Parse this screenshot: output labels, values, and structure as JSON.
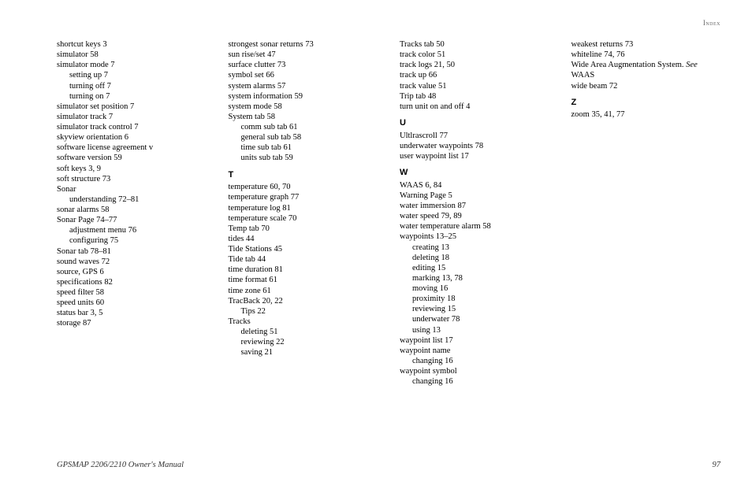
{
  "header": {
    "section": "Index"
  },
  "footer": {
    "title": "GPSMAP 2206/2210 Owner's Manual",
    "page": "97"
  },
  "entries": [
    {
      "t": "shortcut keys  3"
    },
    {
      "t": "simulator  58"
    },
    {
      "t": "simulator mode  7"
    },
    {
      "t": "setting up  7",
      "i": 1
    },
    {
      "t": "turning off  7",
      "i": 1
    },
    {
      "t": "turning on  7",
      "i": 1
    },
    {
      "t": "simulator set position  7"
    },
    {
      "t": "simulator track  7"
    },
    {
      "t": "simulator track control  7"
    },
    {
      "t": "skyview orientation  6"
    },
    {
      "t": "software license agreement  v"
    },
    {
      "t": "software version  59"
    },
    {
      "t": "soft keys  3, 9"
    },
    {
      "t": "soft structure  73"
    },
    {
      "t": "Sonar"
    },
    {
      "t": "understanding  72–81",
      "i": 1
    },
    {
      "t": "sonar alarms  58"
    },
    {
      "t": "Sonar Page  74–77"
    },
    {
      "t": "adjustment menu  76",
      "i": 1
    },
    {
      "t": "configuring  75",
      "i": 1
    },
    {
      "t": "Sonar tab  78–81"
    },
    {
      "t": "sound waves  72"
    },
    {
      "t": "source, GPS  6"
    },
    {
      "t": "specifications  82"
    },
    {
      "t": "speed filter  58"
    },
    {
      "t": "speed units  60"
    },
    {
      "t": "status bar  3, 5"
    },
    {
      "t": "storage  87"
    },
    {
      "t": "strongest sonar returns  73",
      "break": true
    },
    {
      "t": "sun rise/set  47"
    },
    {
      "t": "surface clutter  73"
    },
    {
      "t": "symbol set  66"
    },
    {
      "t": "system alarms  57"
    },
    {
      "t": "system information  59"
    },
    {
      "t": "system mode  58"
    },
    {
      "t": "System tab  58"
    },
    {
      "t": "comm sub tab  61",
      "i": 1
    },
    {
      "t": "general sub tab  58",
      "i": 1
    },
    {
      "t": "time sub tab  61",
      "i": 1
    },
    {
      "t": "units sub tab  59",
      "i": 1
    },
    {
      "letter": "T"
    },
    {
      "t": "temperature  60, 70"
    },
    {
      "t": "temperature graph  77"
    },
    {
      "t": "temperature log  81"
    },
    {
      "t": "temperature scale  70"
    },
    {
      "t": "Temp tab  70"
    },
    {
      "t": "tides  44"
    },
    {
      "t": "Tide Stations  45"
    },
    {
      "t": "Tide tab  44"
    },
    {
      "t": "time duration  81"
    },
    {
      "t": "time format  61"
    },
    {
      "t": "time zone  61"
    },
    {
      "t": "TracBack  20, 22"
    },
    {
      "t": "Tips  22",
      "i": 1
    },
    {
      "t": "Tracks"
    },
    {
      "t": "deleting  51",
      "i": 1
    },
    {
      "t": "reviewing  22",
      "i": 1
    },
    {
      "t": "saving  21",
      "i": 1
    },
    {
      "t": "Tracks tab  50",
      "break": true
    },
    {
      "t": "track color  51"
    },
    {
      "t": "track logs  21, 50"
    },
    {
      "t": "track up  66"
    },
    {
      "t": "track value  51"
    },
    {
      "t": "Trip tab  48"
    },
    {
      "t": "turn unit on and off  4"
    },
    {
      "letter": "U"
    },
    {
      "t": "Ultlrascroll  77"
    },
    {
      "t": "underwater waypoints  78"
    },
    {
      "t": "user waypoint list  17"
    },
    {
      "letter": "W"
    },
    {
      "t": "WAAS  6, 84"
    },
    {
      "t": "Warning Page  5"
    },
    {
      "t": "water immersion  87"
    },
    {
      "t": "water speed  79, 89"
    },
    {
      "t": "water temperature alarm  58"
    },
    {
      "t": "waypoints  13–25"
    },
    {
      "t": "creating  13",
      "i": 1
    },
    {
      "t": "deleting  18",
      "i": 1
    },
    {
      "t": "editing  15",
      "i": 1
    },
    {
      "t": "marking  13, 78",
      "i": 1
    },
    {
      "t": "moving  16",
      "i": 1
    },
    {
      "t": "proximity  18",
      "i": 1
    },
    {
      "t": "reviewing  15",
      "i": 1
    },
    {
      "t": "underwater  78",
      "i": 1
    },
    {
      "t": "using  13",
      "i": 1
    },
    {
      "t": "waypoint list  17"
    },
    {
      "t": "waypoint name"
    },
    {
      "t": "changing  16",
      "i": 1
    },
    {
      "t": "waypoint symbol"
    },
    {
      "t": "changing  16",
      "i": 1
    },
    {
      "t": "weakest returns  73",
      "break": true
    },
    {
      "t": "whiteline  74, 76"
    },
    {
      "see": true,
      "pre": "Wide Area Augmentation System. ",
      "seeword": "See",
      "post": " WAAS"
    },
    {
      "t": "wide beam  72"
    },
    {
      "letter": "Z"
    },
    {
      "t": "zoom  35, 41, 77"
    }
  ]
}
